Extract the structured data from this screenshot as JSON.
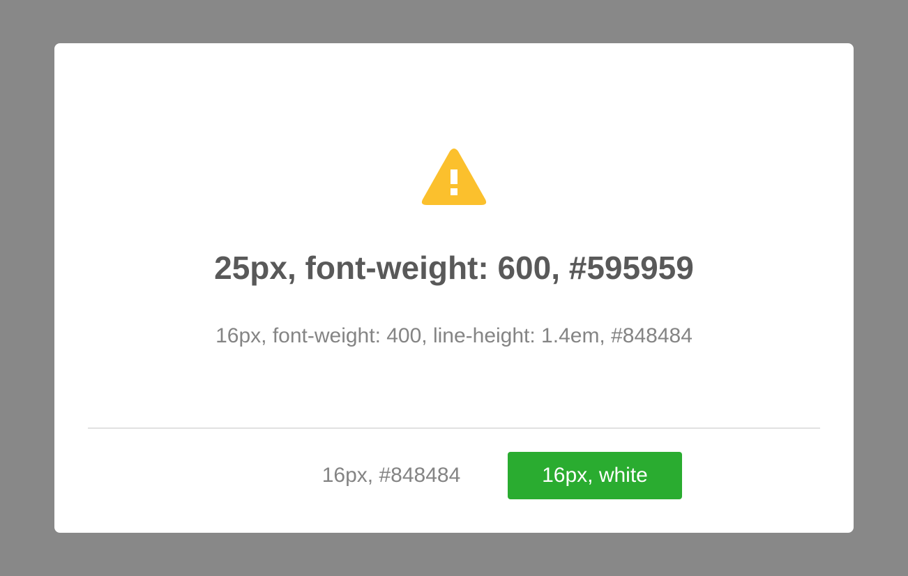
{
  "colors": {
    "backdrop": "#888888",
    "modal_background": "#ffffff",
    "warning_icon": "#fbc02d",
    "warning_icon_mark": "#ffffff",
    "title_text": "#595959",
    "message_text": "#848484",
    "divider": "#e1e1e1",
    "cancel_text": "#848484",
    "confirm_background": "#2aac30",
    "confirm_text": "#ffffff"
  },
  "icon": {
    "name": "warning-triangle-icon"
  },
  "modal": {
    "title": "25px, font-weight: 600, #595959",
    "message": "16px, font-weight: 400, line-height: 1.4em, #848484"
  },
  "actions": {
    "cancel_label": "16px, #848484",
    "confirm_label": "16px, white"
  }
}
